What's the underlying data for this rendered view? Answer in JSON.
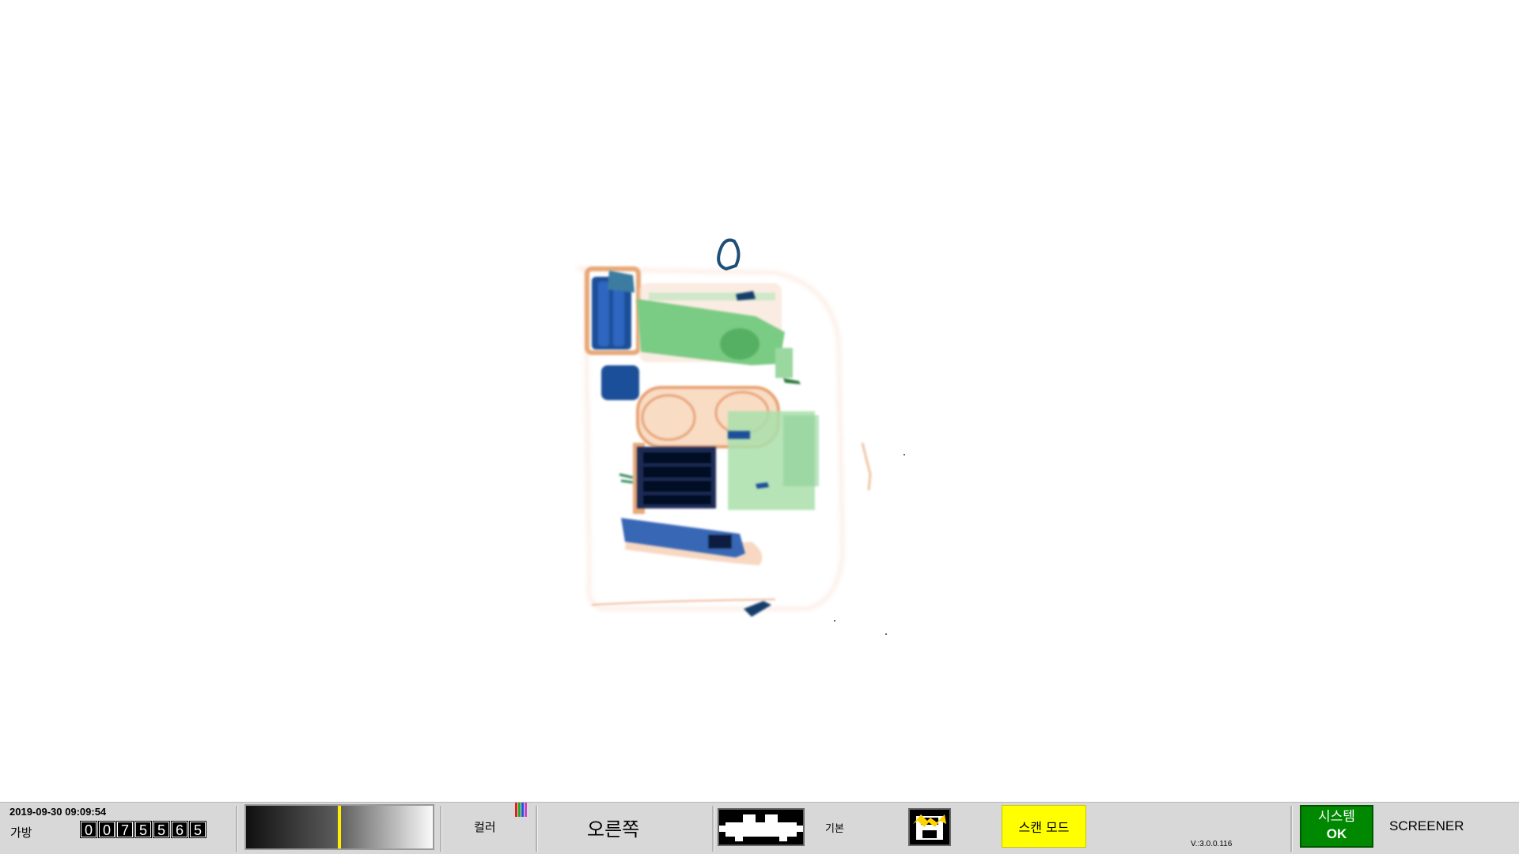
{
  "status_bar": {
    "datetime": "2019-09-30 09:09:54",
    "bag_label": "가방",
    "bag_count_digits": [
      "0",
      "0",
      "7",
      "5",
      "5",
      "6",
      "5"
    ],
    "gray_level": 0.5,
    "color_label": "컬러",
    "color_bar_colors": [
      "#dd2222",
      "#22aa22",
      "#2255dd",
      "#cc44cc"
    ],
    "direction_label": "오른쪽",
    "conveyor_icon": "conveyor-belt-icon",
    "mode_label": "기본",
    "save_icon": "save-disk-icon",
    "scan_mode_label": "스캔 모드",
    "version": "V.:3.0.0.116",
    "system_status_line1": "시스템",
    "system_status_line2": "OK",
    "user_role": "SCREENER"
  },
  "colors": {
    "organic": "#e8a878",
    "mixed": "#5cc070",
    "metal": "#1f4f99",
    "statusbar_bg": "#d8d8d8",
    "scan_mode_bg": "#ffff00",
    "system_ok_bg": "#008800"
  }
}
